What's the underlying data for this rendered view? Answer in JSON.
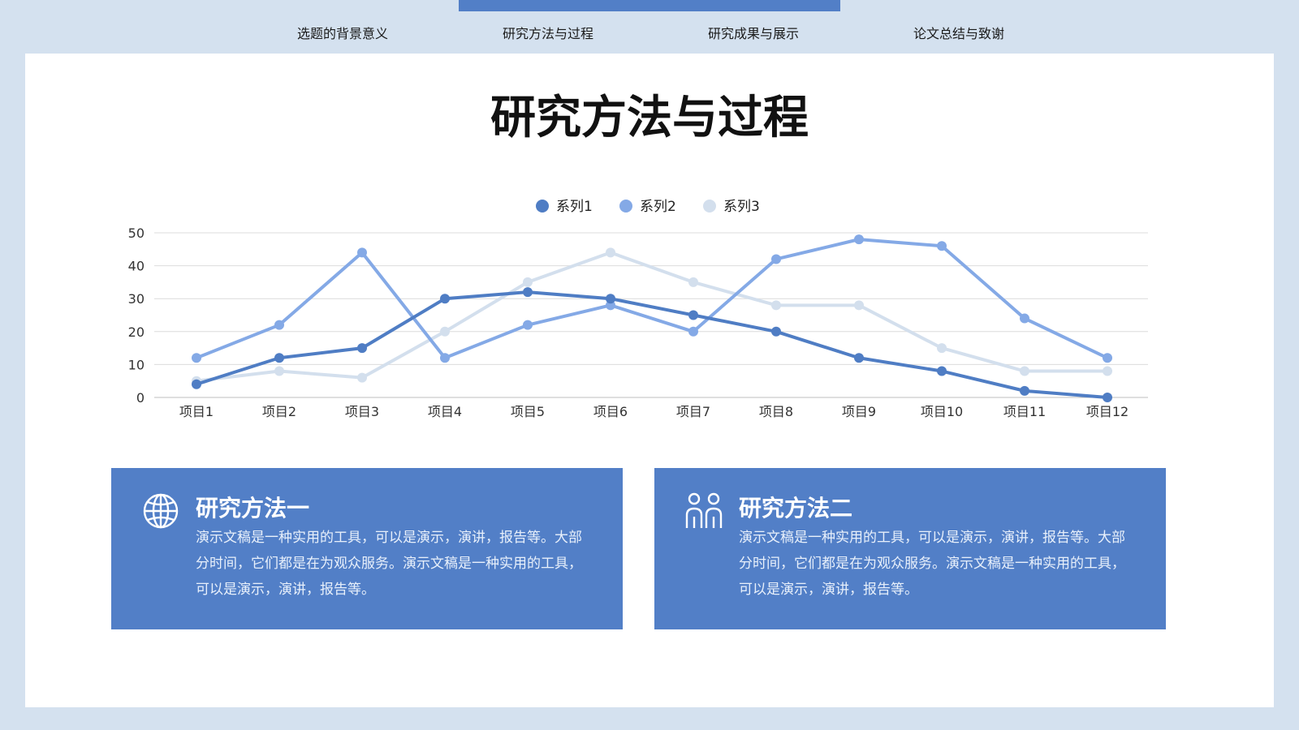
{
  "nav": {
    "tabs": [
      {
        "label": "选题的背景意义"
      },
      {
        "label": "研究方法与过程"
      },
      {
        "label": "研究成果与展示"
      },
      {
        "label": "论文总结与致谢"
      }
    ],
    "active_index": 1
  },
  "main": {
    "title": "研究方法与过程",
    "boxes": [
      {
        "icon": "globe-icon",
        "title": "研究方法一",
        "text": "演示文稿是一种实用的工具，可以是演示，演讲，报告等。大部分时间，它们都是在为观众服务。演示文稿是一种实用的工具，可以是演示，演讲，报告等。"
      },
      {
        "icon": "people-icon",
        "title": "研究方法二",
        "text": "演示文稿是一种实用的工具，可以是演示，演讲，报告等。大部分时间，它们都是在为观众服务。演示文稿是一种实用的工具，可以是演示，演讲，报告等。"
      }
    ]
  },
  "colors": {
    "background": "#d4e1ef",
    "accent": "#527fc7",
    "series1": "#4f7dc4",
    "series2": "#84a9e6",
    "series3": "#d3dfed"
  },
  "chart_data": {
    "type": "line",
    "title": "",
    "xlabel": "",
    "ylabel": "",
    "categories": [
      "项目1",
      "项目2",
      "项目3",
      "项目4",
      "项目5",
      "项目6",
      "项目7",
      "项目8",
      "项目9",
      "项目10",
      "项目11",
      "项目12"
    ],
    "series": [
      {
        "name": "系列1",
        "color": "#4f7dc4",
        "values": [
          4,
          12,
          15,
          30,
          32,
          30,
          25,
          20,
          12,
          8,
          2,
          0
        ]
      },
      {
        "name": "系列2",
        "color": "#84a9e6",
        "values": [
          12,
          22,
          44,
          12,
          22,
          28,
          20,
          42,
          48,
          46,
          24,
          12
        ]
      },
      {
        "name": "系列3",
        "color": "#d3dfed",
        "values": [
          5,
          8,
          6,
          20,
          35,
          44,
          35,
          28,
          28,
          15,
          8,
          8
        ]
      }
    ],
    "ylim": [
      0,
      50
    ],
    "yticks": [
      0,
      10,
      20,
      30,
      40,
      50
    ],
    "grid": true,
    "legend": "top-center"
  }
}
